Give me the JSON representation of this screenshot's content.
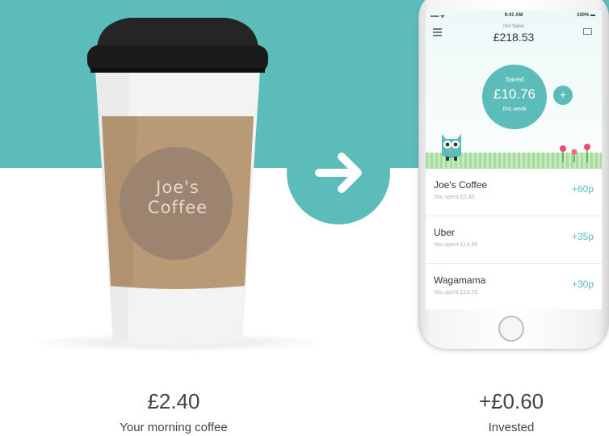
{
  "cup": {
    "brand_text": "Joe's Coffee"
  },
  "left_block": {
    "amount": "£2.40",
    "caption": "Your morning coffee"
  },
  "right_block": {
    "amount": "+£0.60",
    "caption": "Invested"
  },
  "phone": {
    "status_bar": {
      "carrier": "•••••  ᯤ",
      "time": "9:41 AM",
      "battery": "100% ▬"
    },
    "header": {
      "isa_label": "ISA Value",
      "isa_value": "£218.53"
    },
    "saved": {
      "label": "Saved",
      "amount": "£10.76",
      "period": "this week"
    },
    "add_label": "+",
    "transactions": [
      {
        "merchant": "Joe's Coffee",
        "spent": "You spent £2.40",
        "roundup": "+60p"
      },
      {
        "merchant": "Uber",
        "spent": "You spent £14.65",
        "roundup": "+35p"
      },
      {
        "merchant": "Wagamama",
        "spent": "You spent £15.70",
        "roundup": "+30p"
      }
    ]
  },
  "colors": {
    "accent": "#5bbcb9",
    "text": "#444444"
  }
}
